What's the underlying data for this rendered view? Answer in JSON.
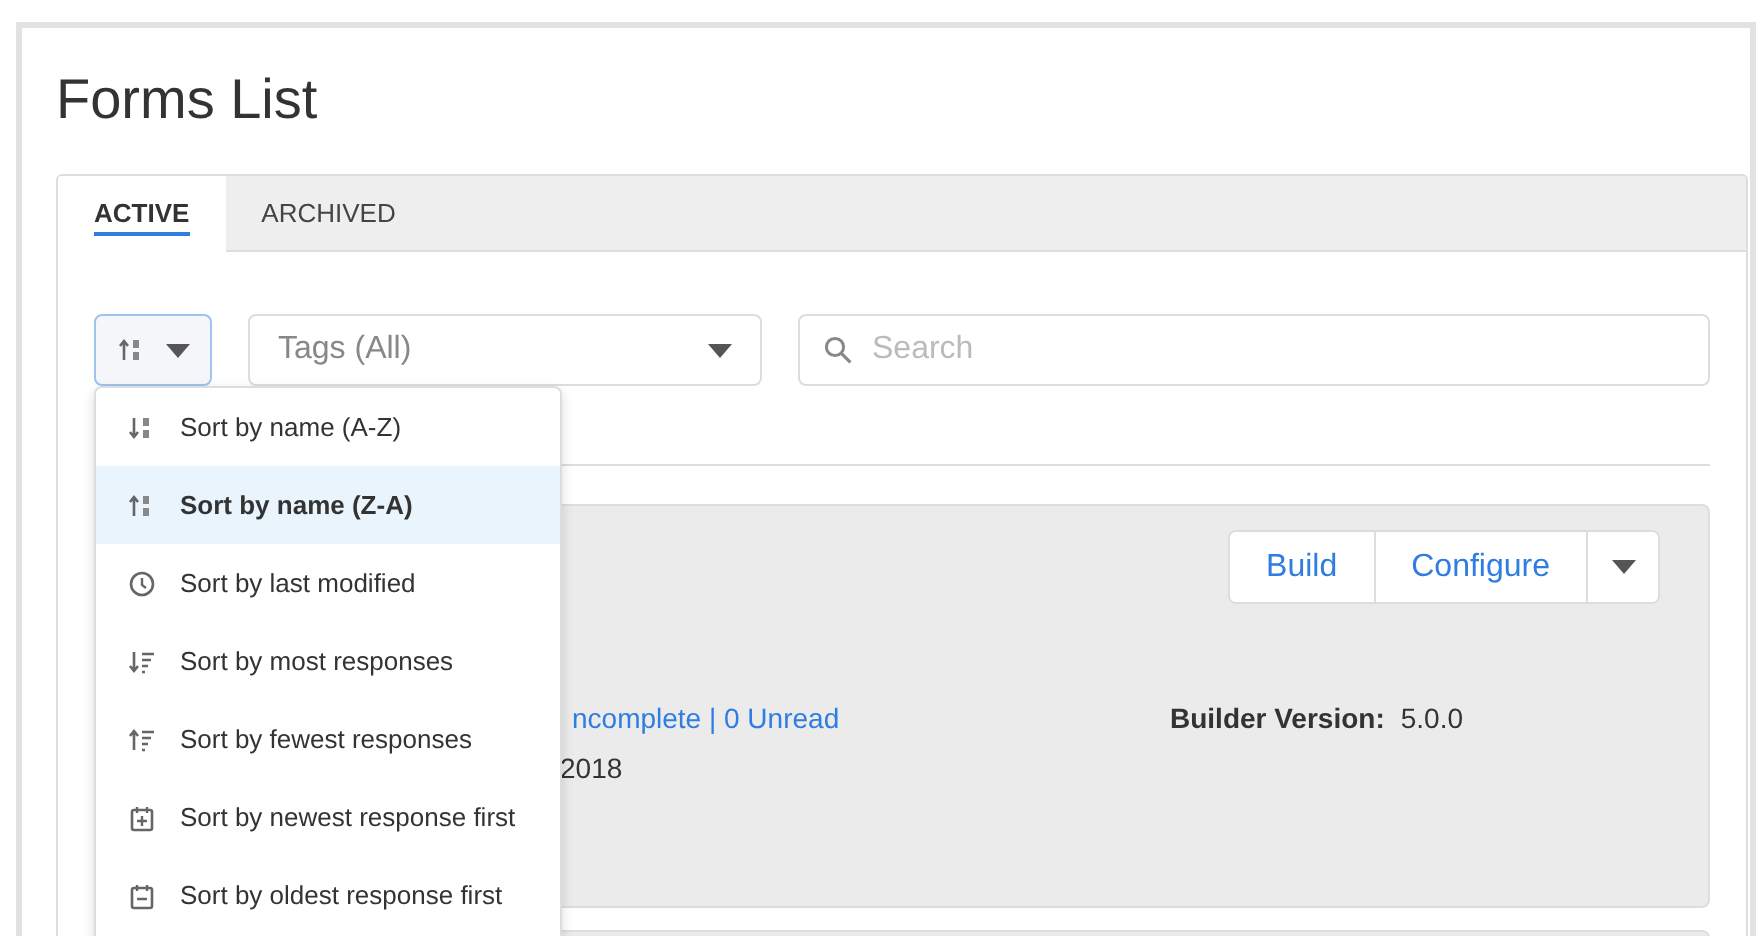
{
  "page": {
    "title": "Forms List"
  },
  "tabs": [
    {
      "label": "ACTIVE",
      "selected": true
    },
    {
      "label": "ARCHIVED",
      "selected": false
    }
  ],
  "toolbar": {
    "tags": {
      "value": "Tags (All)"
    },
    "search": {
      "placeholder": "Search"
    }
  },
  "sort_menu": {
    "expanded": true,
    "items": [
      {
        "label": "Sort by name (A-Z)",
        "kind": "name-asc",
        "selected": false
      },
      {
        "label": "Sort by name (Z-A)",
        "kind": "name-desc",
        "selected": true
      },
      {
        "label": "Sort by last modified",
        "kind": "clock",
        "selected": false
      },
      {
        "label": "Sort by most responses",
        "kind": "count-desc",
        "selected": false
      },
      {
        "label": "Sort by fewest responses",
        "kind": "count-asc",
        "selected": false
      },
      {
        "label": "Sort by newest response first",
        "kind": "cal-new",
        "selected": false
      },
      {
        "label": "Sort by oldest response first",
        "kind": "cal-old",
        "selected": false
      }
    ]
  },
  "form_card": {
    "buttons": [
      "Build",
      "Configure"
    ],
    "responses_link": "ncomplete | 0 Unread",
    "date": "2018",
    "builder_version_label": "Builder Version:",
    "builder_version": "5.0.0"
  }
}
